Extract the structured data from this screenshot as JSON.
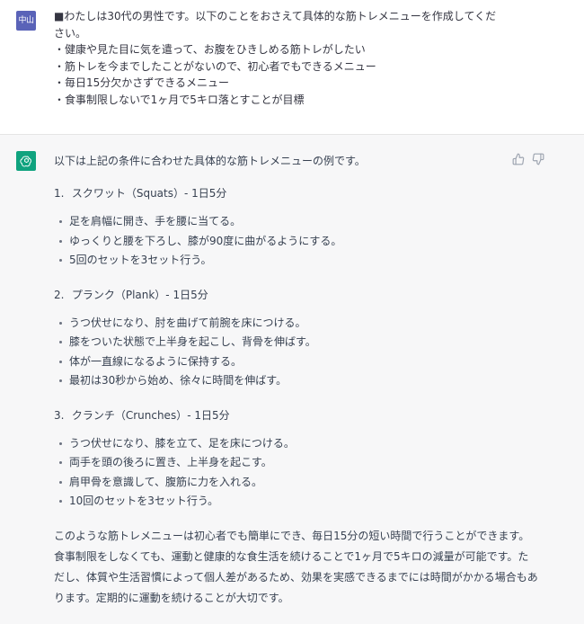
{
  "user": {
    "avatar_label": "中山",
    "lines": [
      "■わたしは30代の男性です。以下のことをおさえて具体的な筋トレメニューを作成してくだ",
      "さい。",
      "・健康や見た目に気を遣って、お腹をひきしめる筋トレがしたい",
      "・筋トレを今までしたことがないので、初心者でもできるメニュー",
      "・毎日15分欠かさずできるメニュー",
      "・食事制限しないで1ヶ月で5キロ落とすことが目標"
    ]
  },
  "assistant": {
    "avatar_icon": "openai-logo-icon",
    "accent_color": "#10a37f",
    "intro": "以下は上記の条件に合わせた具体的な筋トレメニューの例です。",
    "sections": [
      {
        "number": "1.",
        "title": "スクワット（Squats）- 1日5分",
        "bullets": [
          "足を肩幅に開き、手を腰に当てる。",
          "ゆっくりと腰を下ろし、膝が90度に曲がるようにする。",
          "5回のセットを3セット行う。"
        ]
      },
      {
        "number": "2.",
        "title": "プランク（Plank）- 1日5分",
        "bullets": [
          "うつ伏せになり、肘を曲げて前腕を床につける。",
          "膝をついた状態で上半身を起こし、背骨を伸ばす。",
          "体が一直線になるように保持する。",
          "最初は30秒から始め、徐々に時間を伸ばす。"
        ]
      },
      {
        "number": "3.",
        "title": "クランチ（Crunches）- 1日5分",
        "bullets": [
          "うつ伏せになり、膝を立て、足を床につける。",
          "両手を頭の後ろに置き、上半身を起こす。",
          "肩甲骨を意識して、腹筋に力を入れる。",
          "10回のセットを3セット行う。"
        ]
      }
    ],
    "conclusion": "このような筋トレメニューは初心者でも簡単にでき、毎日15分の短い時間で行うことができます。食事制限をしなくても、運動と健康的な食生活を続けることで1ヶ月で5キロの減量が可能です。ただし、体質や生活習慣によって個人差があるため、効果を実感できるまでには時間がかかる場合もあります。定期的に運動を続けることが大切です。",
    "feedback": [
      "thumbs-up-icon",
      "thumbs-down-icon"
    ]
  }
}
